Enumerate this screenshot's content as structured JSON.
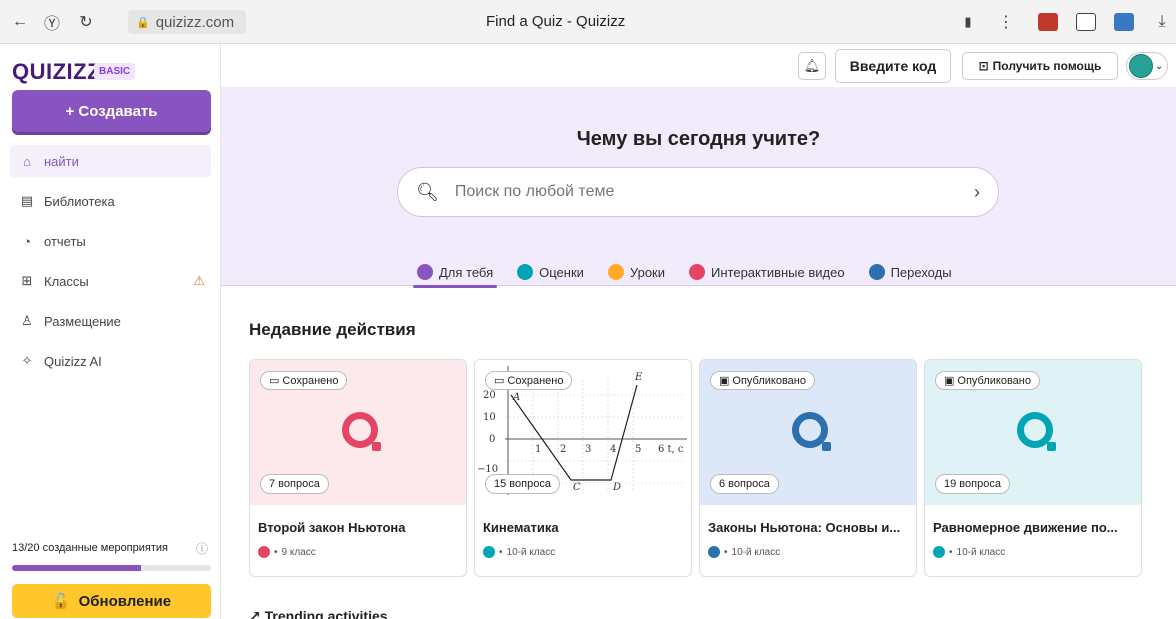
{
  "browser": {
    "url": "quizizz.com",
    "title": "Find a Quiz - Quizizz"
  },
  "sidebar": {
    "logo": "QUIZIZZ",
    "plan_badge": "BASIC",
    "create_label": "+ Создавать",
    "items": [
      {
        "label": "найти",
        "icon": "home-icon",
        "active": true
      },
      {
        "label": "Библиотека",
        "icon": "library-icon"
      },
      {
        "label": "отчеты",
        "icon": "reports-icon"
      },
      {
        "label": "Классы",
        "icon": "classes-icon",
        "warning": true
      },
      {
        "label": "Размещение",
        "icon": "accommodation-icon"
      },
      {
        "label": "Quizizz AI",
        "icon": "sparkle-icon"
      }
    ],
    "usage_text": "13/20 созданные мероприятия",
    "usage_fraction": 0.65,
    "upgrade_label": "Обновление"
  },
  "topbar": {
    "code_button": "Введите код",
    "help_button": "Получить помощь"
  },
  "hero": {
    "title": "Чему вы сегодня учите?",
    "search_placeholder": "Поиск по любой теме",
    "tabs": [
      {
        "label": "Для тебя",
        "color": "#8854c0",
        "active": true
      },
      {
        "label": "Оценки",
        "color": "#00a5b5"
      },
      {
        "label": "Уроки",
        "color": "#ffa928"
      },
      {
        "label": "Интерактивные видео",
        "color": "#e54563"
      },
      {
        "label": "Переходы",
        "color": "#2d70ae"
      }
    ]
  },
  "recent": {
    "title": "Недавние действия",
    "cards": [
      {
        "status": "Сохранено",
        "count": "7 вопроса",
        "title": "Второй закон Ньютона",
        "grade": "9 класс",
        "type_color": "#e54563",
        "bg": "#fbe9ec",
        "logo_color": "#e54563"
      },
      {
        "status": "Сохранено",
        "count": "15 вопроса",
        "title": "Кинематика",
        "grade": "10-й класс",
        "type_color": "#00a5b5",
        "bg": "#ffffff",
        "logo_color": "#222222"
      },
      {
        "status": "Опубликовано",
        "count": "6 вопроса",
        "title": "Законы Ньютона: Основы и...",
        "grade": "10-й класс",
        "type_color": "#2d70ae",
        "bg": "#dce8f8",
        "logo_color": "#2d70ae"
      },
      {
        "status": "Опубликовано",
        "count": "19 вопроса",
        "title": "Равномерное движение по...",
        "grade": "10-й класс",
        "type_color": "#00a5b5",
        "bg": "#dff3f6",
        "logo_color": "#00a5b5"
      }
    ]
  },
  "trending_title": "Trending activities"
}
